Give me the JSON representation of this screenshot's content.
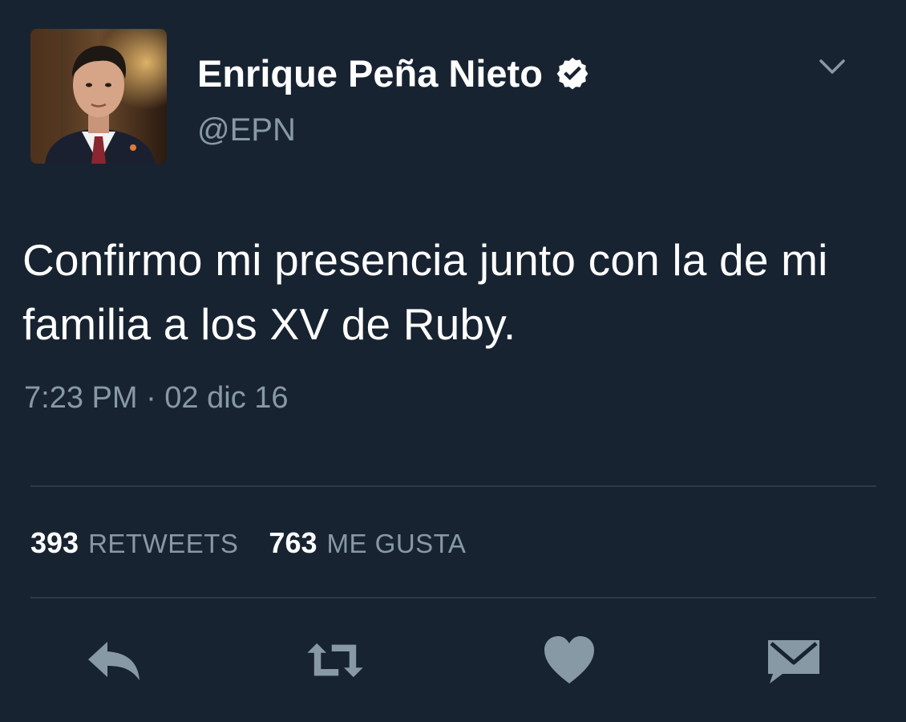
{
  "tweet": {
    "author": {
      "display_name": "Enrique Peña Nieto",
      "handle": "@EPN",
      "verified": true
    },
    "text": "Confirmo mi presencia junto con la de mi familia a los XV de Ruby.",
    "timestamp": "7:23 PM · 02 dic 16",
    "stats": {
      "retweets_count": "393",
      "retweets_label": "RETWEETS",
      "likes_count": "763",
      "likes_label": "ME GUSTA"
    },
    "actions": [
      {
        "name": "reply",
        "icon": "reply-icon"
      },
      {
        "name": "retweet",
        "icon": "retweet-icon"
      },
      {
        "name": "like",
        "icon": "heart-icon"
      },
      {
        "name": "direct-message",
        "icon": "envelope-icon"
      }
    ]
  },
  "colors": {
    "background": "#182331",
    "primary_text": "#ffffff",
    "secondary_text": "#8899a6",
    "divider": "#2b3a4a",
    "icon": "#8899a6"
  }
}
